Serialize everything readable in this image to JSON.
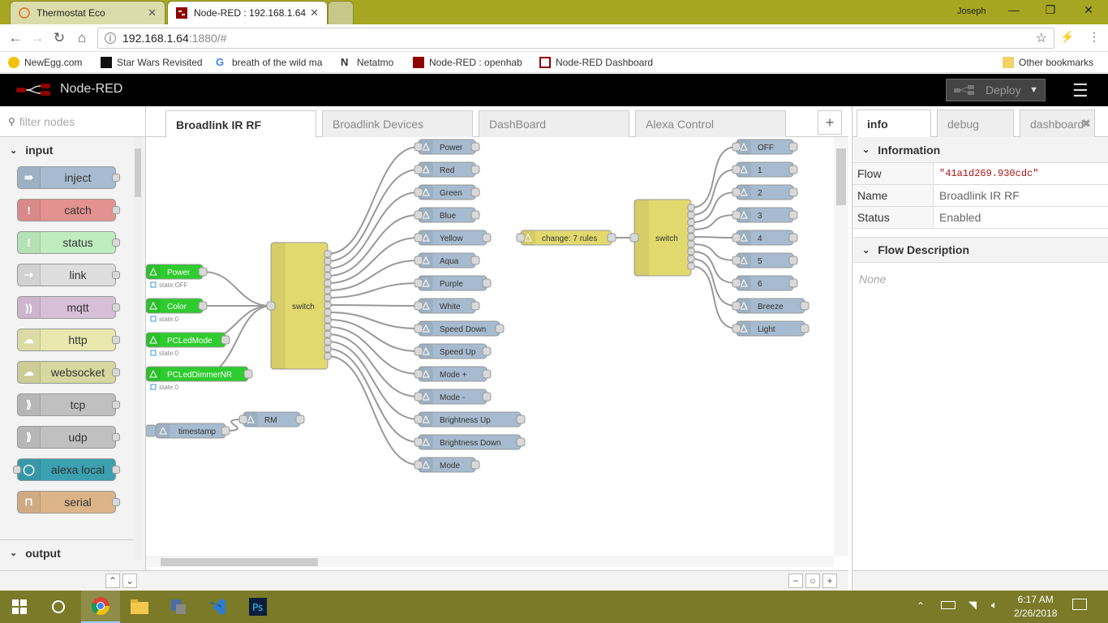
{
  "browser": {
    "tabs": [
      {
        "title": "Thermostat Eco"
      },
      {
        "title": "Node-RED : 192.168.1.64"
      }
    ],
    "user": "Joseph",
    "url_host": "192.168.1.64",
    "url_path": ":1880/#",
    "bookmarks": [
      "NewEgg.com",
      "Star Wars Revisited",
      "breath of the wild ma",
      "Netatmo",
      "Node-RED : openhab",
      "Node-RED Dashboard"
    ],
    "other_bookmarks": "Other bookmarks"
  },
  "header": {
    "app_title": "Node-RED",
    "deploy_label": "Deploy"
  },
  "palette": {
    "filter_placeholder": "filter nodes",
    "category_input": "input",
    "category_output": "output",
    "nodes": [
      {
        "label": "inject",
        "color": "#a6bbcf"
      },
      {
        "label": "catch",
        "color": "#e49191"
      },
      {
        "label": "status",
        "color": "#c0edc0"
      },
      {
        "label": "link",
        "color": "#dddddd"
      },
      {
        "label": "mqtt",
        "color": "#d8bfd8"
      },
      {
        "label": "http",
        "color": "#e7e7ae"
      },
      {
        "label": "websocket",
        "color": "#d7d7a0"
      },
      {
        "label": "tcp",
        "color": "#c0c0c0"
      },
      {
        "label": "udp",
        "color": "#c0c0c0"
      },
      {
        "label": "alexa local",
        "color": "#3ba0b0"
      },
      {
        "label": "serial",
        "color": "#dcb48a"
      }
    ]
  },
  "workspace": {
    "tabs": [
      "Broadlink IR RF",
      "Broadlink Devices",
      "DashBoard",
      "Alexa Control"
    ],
    "nodes": {
      "left_switch": "switch",
      "right_switch": "switch",
      "change": "change: 7 rules",
      "timestamp": "timestamp",
      "rm": "RM",
      "inputs": [
        {
          "label": "Power",
          "status": "state:OFF"
        },
        {
          "label": "Color",
          "status": "state:0"
        },
        {
          "label": "PCLedMode",
          "status": "state:0"
        },
        {
          "label": "PCLedDimmerNR",
          "status": "state:0"
        }
      ],
      "outputs_left": [
        "Power",
        "Red",
        "Green",
        "Blue",
        "Yellow",
        "Aqua",
        "Purple",
        "White",
        "Speed Down",
        "Speed Up",
        "Mode +",
        "Mode -",
        "Brightness Up",
        "Brightness Down",
        "Mode"
      ],
      "outputs_right": [
        "OFF",
        "1",
        "2",
        "3",
        "4",
        "5",
        "6",
        "Breeze",
        "Light"
      ]
    }
  },
  "sidebar": {
    "tabs": [
      "info",
      "debug",
      "dashboard"
    ],
    "information_title": "Information",
    "rows": [
      {
        "key": "Flow",
        "value": "\"41a1d269.930cdc\""
      },
      {
        "key": "Name",
        "value": "Broadlink IR RF"
      },
      {
        "key": "Status",
        "value": "Enabled"
      }
    ],
    "flow_description_title": "Flow Description",
    "flow_description": "None"
  },
  "taskbar": {
    "time": "6:17 AM",
    "date": "2/26/2018"
  }
}
